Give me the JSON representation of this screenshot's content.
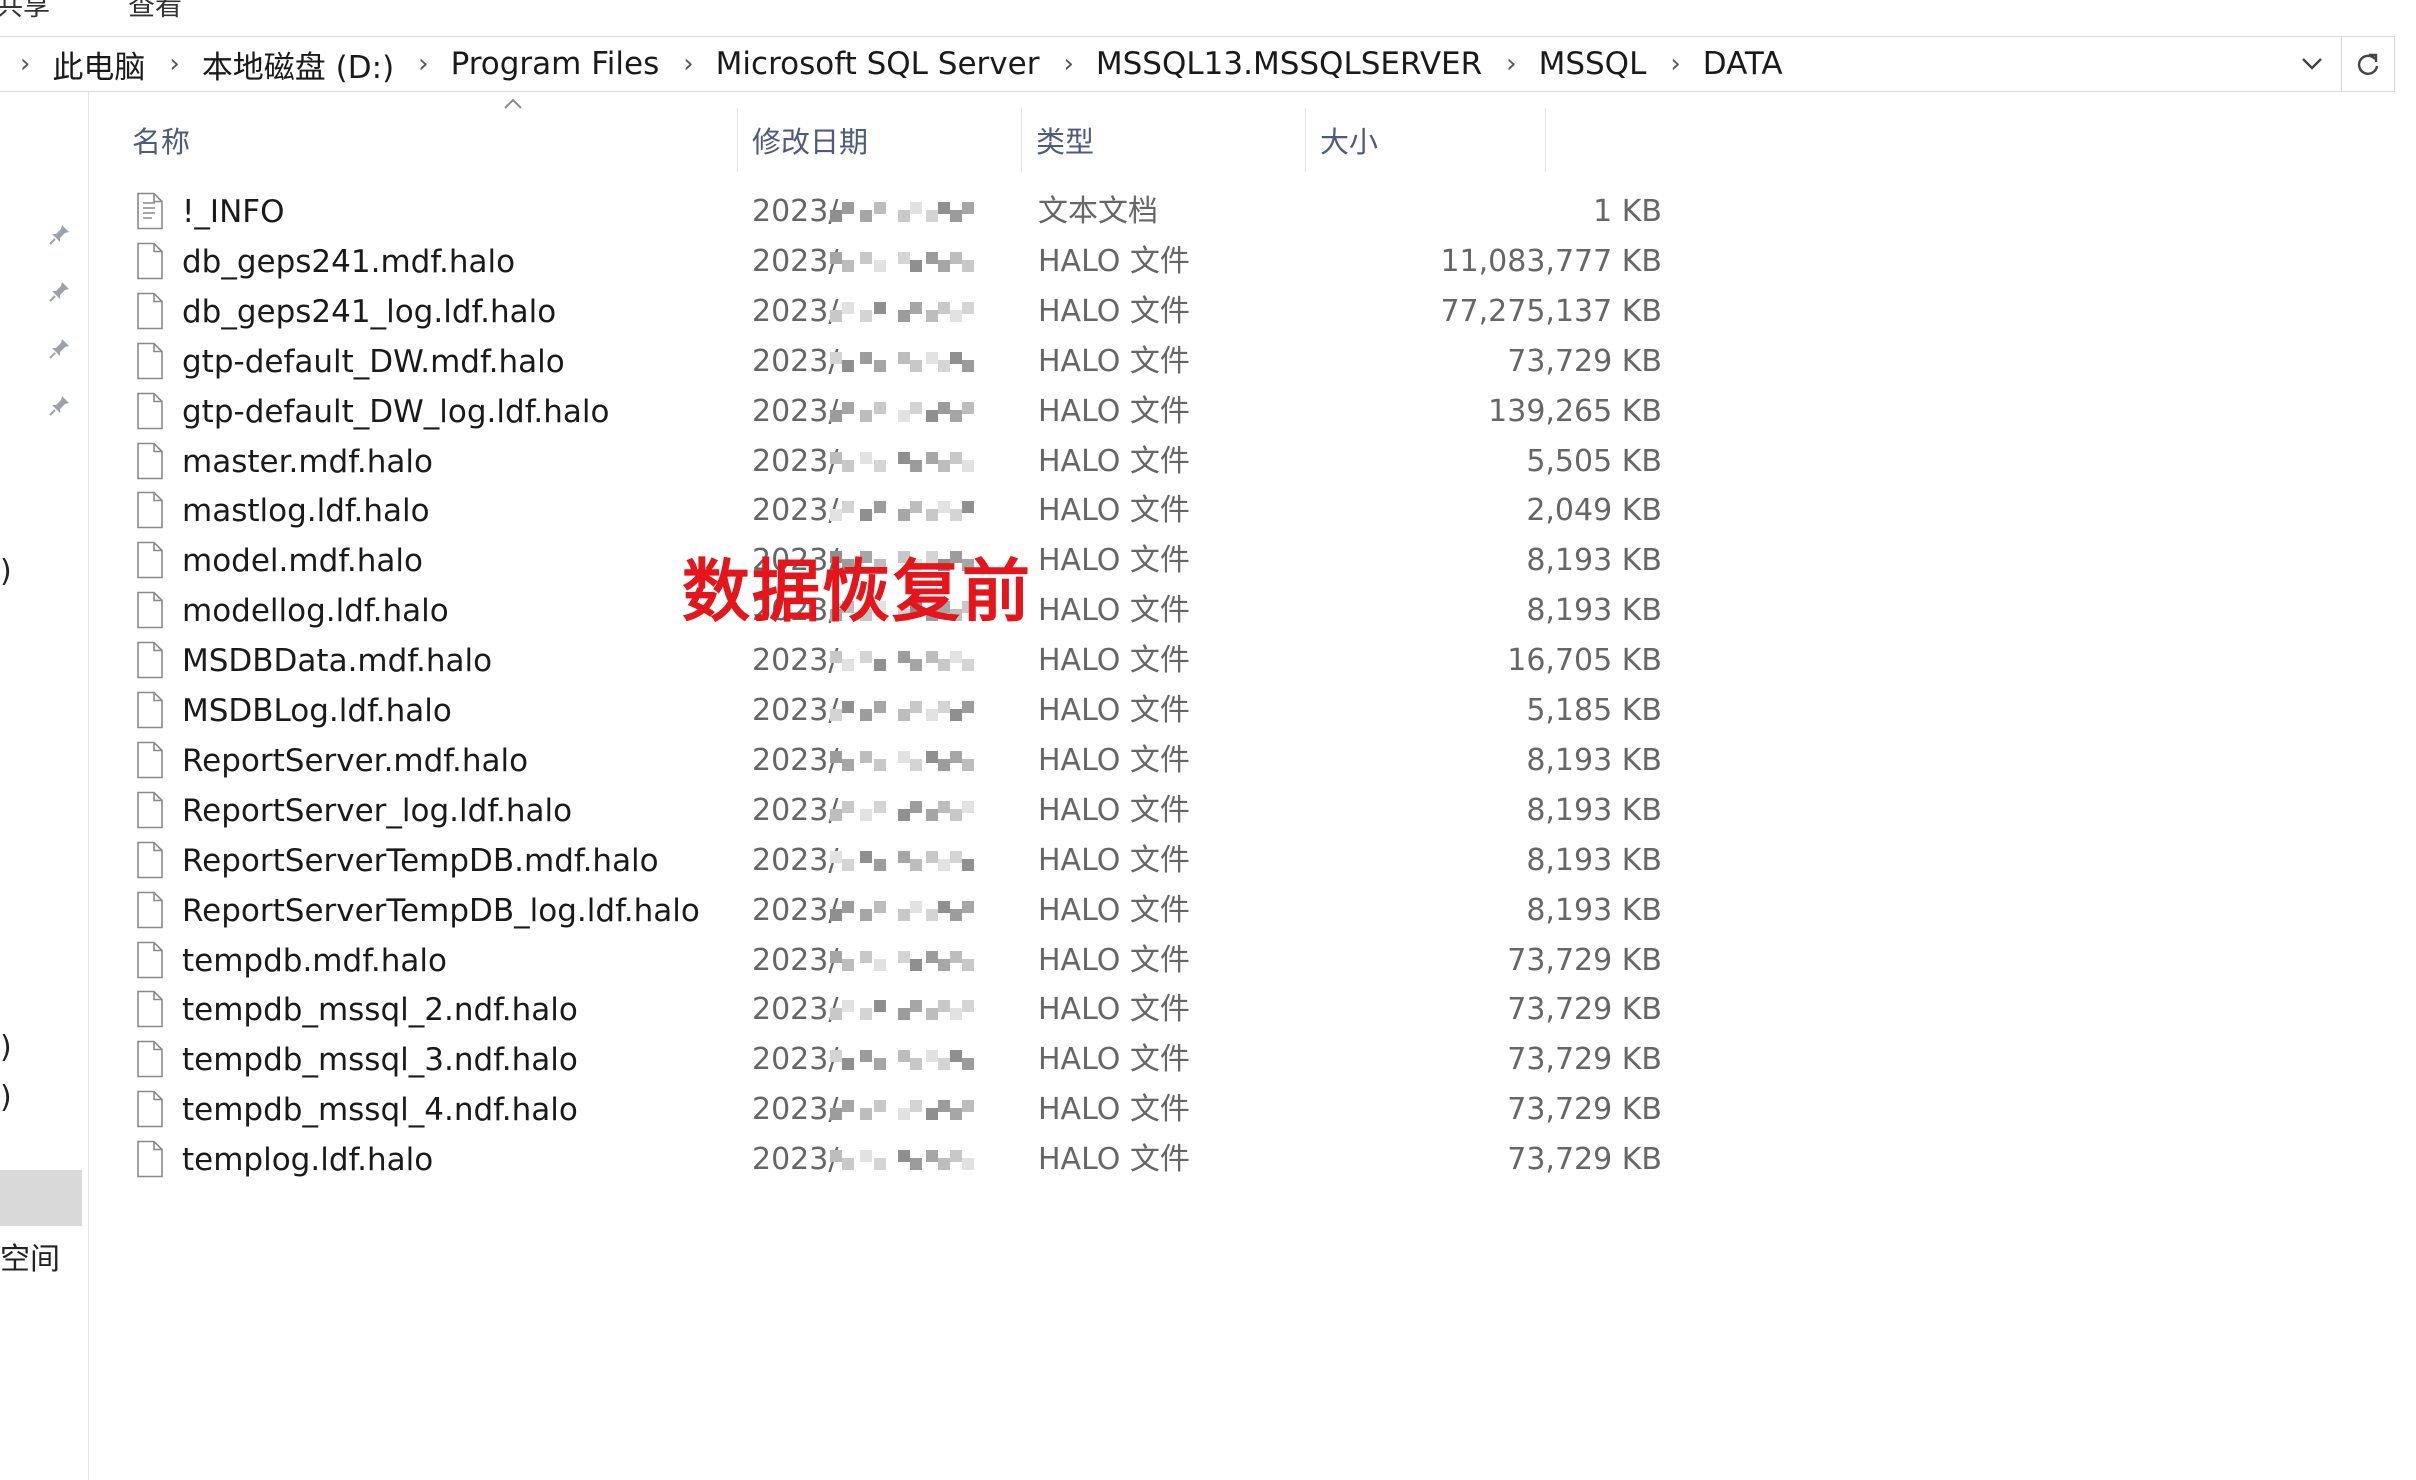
{
  "ribbon": {
    "frag_left": "共享",
    "frag_right": "查看"
  },
  "breadcrumb": [
    "此电脑",
    "本地磁盘 (D:)",
    "Program Files",
    "Microsoft SQL Server",
    "MSSQL13.MSSQLSERVER",
    "MSSQL",
    "DATA"
  ],
  "nav": {
    "frag_a": ")",
    "frag_b": ")",
    "frag_c": ")",
    "frag_space": "空间"
  },
  "columns": {
    "name": "名称",
    "date": "修改日期",
    "type": "类型",
    "size": "大小"
  },
  "files": [
    {
      "name": "!_INFO",
      "date": "2023/",
      "type": "文本文档",
      "size": "1 KB",
      "icon": "text-file-icon"
    },
    {
      "name": "db_geps241.mdf.halo",
      "date": "2023/",
      "type": "HALO 文件",
      "size": "11,083,777 KB",
      "icon": "blank-file-icon"
    },
    {
      "name": "db_geps241_log.ldf.halo",
      "date": "2023/",
      "type": "HALO 文件",
      "size": "77,275,137 KB",
      "icon": "blank-file-icon"
    },
    {
      "name": "gtp-default_DW.mdf.halo",
      "date": "2023/",
      "type": "HALO 文件",
      "size": "73,729 KB",
      "icon": "blank-file-icon"
    },
    {
      "name": "gtp-default_DW_log.ldf.halo",
      "date": "2023/",
      "type": "HALO 文件",
      "size": "139,265 KB",
      "icon": "blank-file-icon"
    },
    {
      "name": "master.mdf.halo",
      "date": "2023/",
      "type": "HALO 文件",
      "size": "5,505 KB",
      "icon": "blank-file-icon"
    },
    {
      "name": "mastlog.ldf.halo",
      "date": "2023/",
      "type": "HALO 文件",
      "size": "2,049 KB",
      "icon": "blank-file-icon"
    },
    {
      "name": "model.mdf.halo",
      "date": "2023/",
      "type": "HALO 文件",
      "size": "8,193 KB",
      "icon": "blank-file-icon"
    },
    {
      "name": "modellog.ldf.halo",
      "date": "2023/",
      "type": "HALO 文件",
      "size": "8,193 KB",
      "icon": "blank-file-icon"
    },
    {
      "name": "MSDBData.mdf.halo",
      "date": "2023/",
      "type": "HALO 文件",
      "size": "16,705 KB",
      "icon": "blank-file-icon"
    },
    {
      "name": "MSDBLog.ldf.halo",
      "date": "2023/",
      "type": "HALO 文件",
      "size": "5,185 KB",
      "icon": "blank-file-icon"
    },
    {
      "name": "ReportServer.mdf.halo",
      "date": "2023/",
      "type": "HALO 文件",
      "size": "8,193 KB",
      "icon": "blank-file-icon"
    },
    {
      "name": "ReportServer_log.ldf.halo",
      "date": "2023/",
      "type": "HALO 文件",
      "size": "8,193 KB",
      "icon": "blank-file-icon"
    },
    {
      "name": "ReportServerTempDB.mdf.halo",
      "date": "2023/",
      "type": "HALO 文件",
      "size": "8,193 KB",
      "icon": "blank-file-icon"
    },
    {
      "name": "ReportServerTempDB_log.ldf.halo",
      "date": "2023/",
      "type": "HALO 文件",
      "size": "8,193 KB",
      "icon": "blank-file-icon"
    },
    {
      "name": "tempdb.mdf.halo",
      "date": "2023/",
      "type": "HALO 文件",
      "size": "73,729 KB",
      "icon": "blank-file-icon"
    },
    {
      "name": "tempdb_mssql_2.ndf.halo",
      "date": "2023/",
      "type": "HALO 文件",
      "size": "73,729 KB",
      "icon": "blank-file-icon"
    },
    {
      "name": "tempdb_mssql_3.ndf.halo",
      "date": "2023/",
      "type": "HALO 文件",
      "size": "73,729 KB",
      "icon": "blank-file-icon"
    },
    {
      "name": "tempdb_mssql_4.ndf.halo",
      "date": "2023/",
      "type": "HALO 文件",
      "size": "73,729 KB",
      "icon": "blank-file-icon"
    },
    {
      "name": "templog.ldf.halo",
      "date": "2023/",
      "type": "HALO 文件",
      "size": "73,729 KB",
      "icon": "blank-file-icon"
    }
  ],
  "overlay_text": "数据恢复前",
  "colors": {
    "overlay": "#e4161b",
    "header_text": "#4f5b7c",
    "secondary_text": "#666666",
    "selection": "#d9d9d9"
  }
}
